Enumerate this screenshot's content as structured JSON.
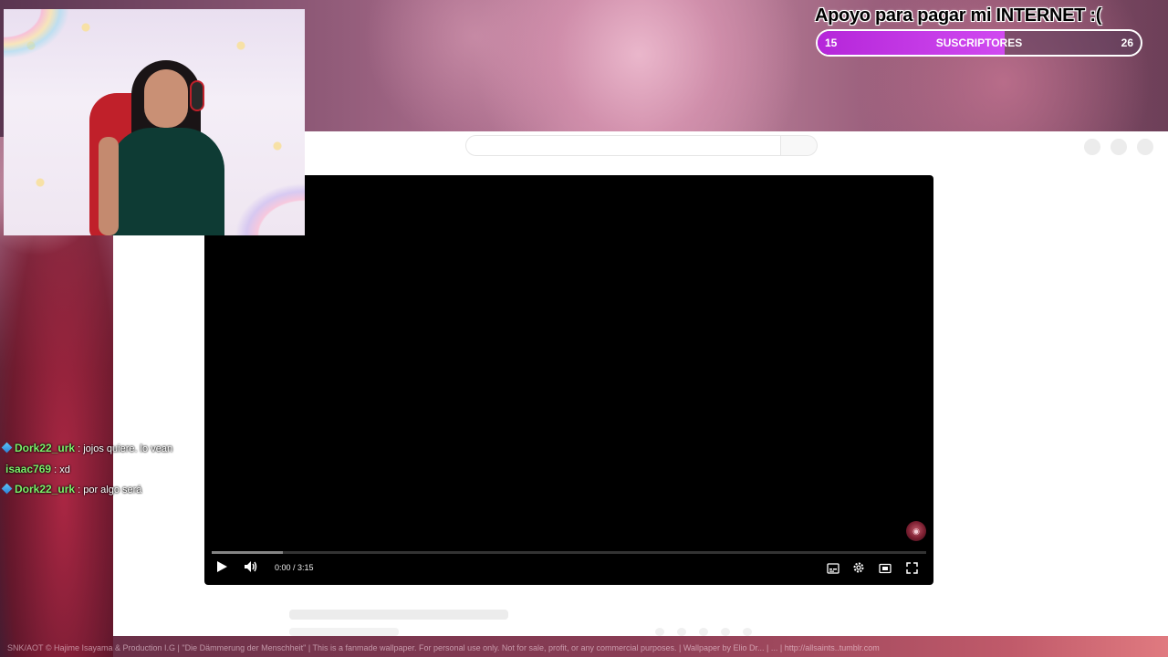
{
  "goal": {
    "title": "Apoyo para pagar mi INTERNET :(",
    "current": "15",
    "label": "SUSCRIPTORES",
    "target": "26",
    "progress": 0.58,
    "fill_color": "#c33be6"
  },
  "player": {
    "time": "0:00 / 3:15",
    "buffered": 0.1,
    "icons": {
      "play": "play-icon",
      "volume": "volume-icon",
      "subtitles": "subtitles-icon",
      "settings": "gear-icon",
      "theater": "theater-mode-icon",
      "fullscreen": "fullscreen-icon"
    }
  },
  "chat": {
    "messages": [
      {
        "badge": true,
        "user": "Dork22_urk",
        "text": " : jojos quiere. lo vean"
      },
      {
        "badge": false,
        "user": "isaac769",
        "text": " : xd"
      },
      {
        "badge": true,
        "user": "Dork22_urk",
        "text": " : por algo será"
      }
    ]
  },
  "background": {
    "credit": "SNK/AOT © Hajime Isayama & Production I.G | \"Die Dämmerung der Menschheit\" | This is a fanmade wallpaper. For personal use only. Not for sale, profit, or any commercial purposes. | Wallpaper by Elio Dr... | ... | http://allsaints..tumblr.com"
  }
}
